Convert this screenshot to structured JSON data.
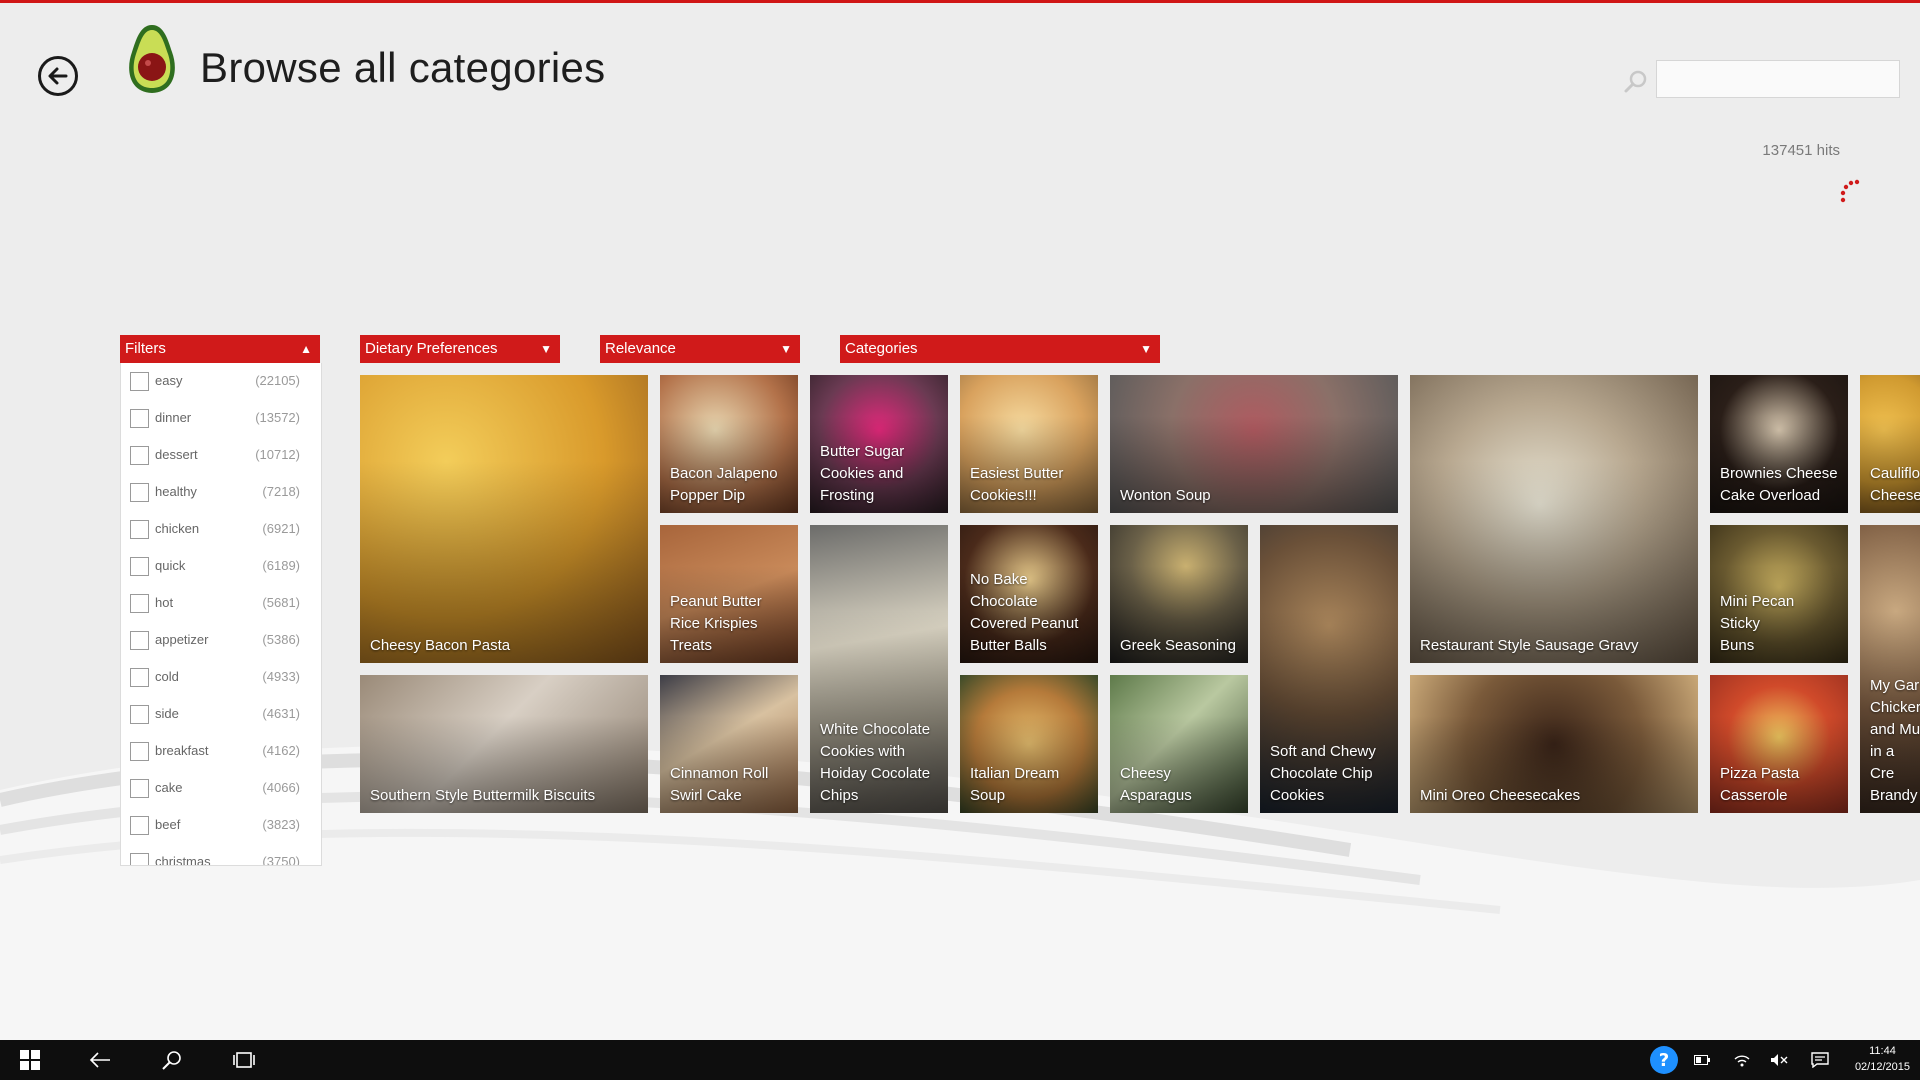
{
  "header": {
    "title": "Browse all categories",
    "search_placeholder": "",
    "hits": "137451 hits"
  },
  "dropdowns": {
    "filters": "Filters",
    "dietary": "Dietary Preferences",
    "sort": "Relevance",
    "categories": "Categories"
  },
  "filters": [
    {
      "name": "easy",
      "count": "(22105)"
    },
    {
      "name": "dinner",
      "count": "(13572)"
    },
    {
      "name": "dessert",
      "count": "(10712)"
    },
    {
      "name": "healthy",
      "count": "(7218)"
    },
    {
      "name": "chicken",
      "count": "(6921)"
    },
    {
      "name": "quick",
      "count": "(6189)"
    },
    {
      "name": "hot",
      "count": "(5681)"
    },
    {
      "name": "appetizer",
      "count": "(5386)"
    },
    {
      "name": "cold",
      "count": "(4933)"
    },
    {
      "name": "side",
      "count": "(4631)"
    },
    {
      "name": "breakfast",
      "count": "(4162)"
    },
    {
      "name": "cake",
      "count": "(4066)"
    },
    {
      "name": "beef",
      "count": "(3823)"
    },
    {
      "name": "christmas",
      "count": "(3750)"
    }
  ],
  "recipes": [
    "Cheesy Bacon Pasta",
    "Southern Style Buttermilk Biscuits",
    "Bacon Jalapeno\nPopper Dip",
    "Peanut Butter\nRice Krispies\nTreats",
    "Cinnamon Roll\nSwirl Cake",
    "Butter Sugar\nCookies and\nFrosting",
    "White Chocolate\nCookies with\nHoiday Cocolate\nChips",
    "Easiest Butter\nCookies!!!",
    "No Bake\nChocolate\nCovered Peanut\nButter Balls",
    "Italian Dream\nSoup",
    "Wonton Soup",
    "Greek Seasoning",
    "Cheesy\nAsparagus",
    "Soft and Chewy\nChocolate Chip\nCookies",
    "Restaurant Style Sausage Gravy",
    "Mini Oreo Cheesecakes",
    "Brownies Cheese\nCake Overload",
    "Mini Pecan Sticky\nBuns",
    "Pizza Pasta\nCasserole",
    "Cauliflo\nCheese",
    "My Gar\nChicker\nand Mu\nin a Cre\nBrandy"
  ],
  "taskbar": {
    "time": "11:44",
    "date": "02/12/2015"
  },
  "colors": {
    "accent": "#d01a1a",
    "background": "#ededed",
    "taskbar": "#0e0e0e"
  }
}
